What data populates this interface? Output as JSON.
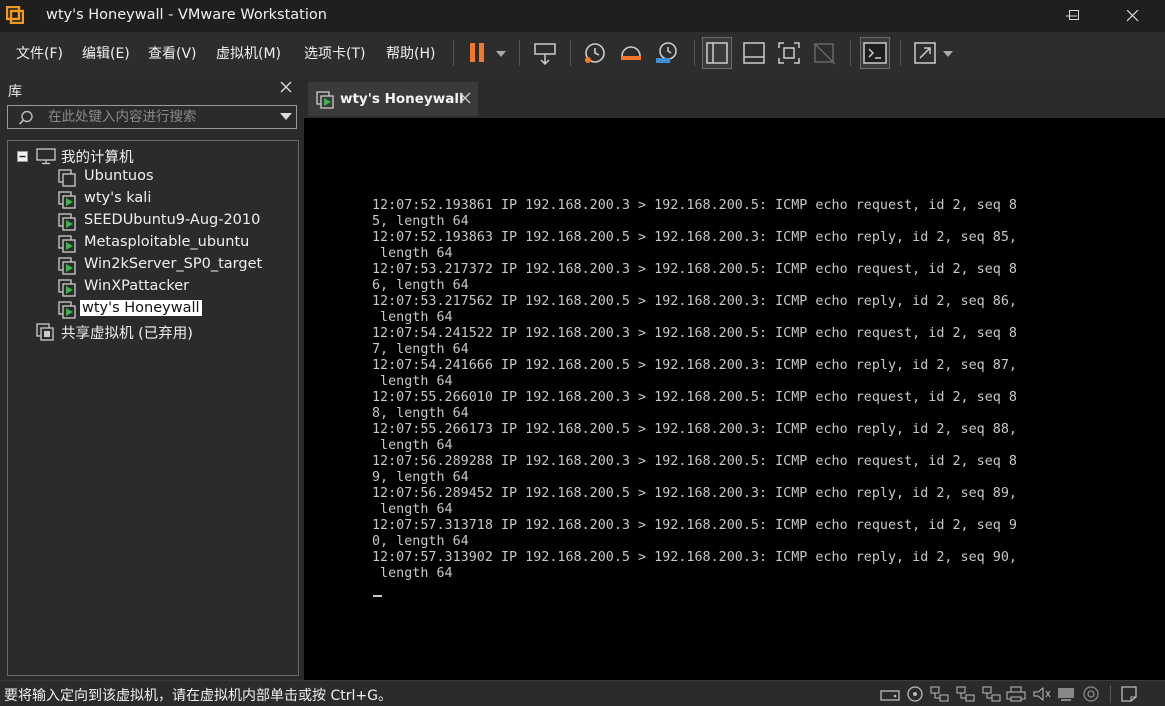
{
  "window": {
    "title": "wty's Honeywall - VMware Workstation"
  },
  "menu": [
    "文件(F)",
    "编辑(E)",
    "查看(V)",
    "虚拟机(M)",
    "选项卡(T)",
    "帮助(H)"
  ],
  "library": {
    "title": "库",
    "search_placeholder": "在此处键入内容进行搜索",
    "root": "我的计算机",
    "vms": [
      "Ubuntuos",
      "wty's kali",
      "SEEDUbuntu9-Aug-2010",
      "Metasploitable_ubuntu",
      "Win2kServer_SP0_target",
      "WinXPattacker",
      "wty's Honeywall"
    ],
    "selected_vm": "wty's Honeywall",
    "shared": "共享虚拟机 (已弃用)"
  },
  "tab": {
    "label": "wty's Honeywall"
  },
  "console": {
    "lines": [
      "12:07:52.193861 IP 192.168.200.3 > 192.168.200.5: ICMP echo request, id 2, seq 8",
      "5, length 64",
      "12:07:52.193863 IP 192.168.200.5 > 192.168.200.3: ICMP echo reply, id 2, seq 85,",
      " length 64",
      "12:07:53.217372 IP 192.168.200.3 > 192.168.200.5: ICMP echo request, id 2, seq 8",
      "6, length 64",
      "12:07:53.217562 IP 192.168.200.5 > 192.168.200.3: ICMP echo reply, id 2, seq 86,",
      " length 64",
      "12:07:54.241522 IP 192.168.200.3 > 192.168.200.5: ICMP echo request, id 2, seq 8",
      "7, length 64",
      "12:07:54.241666 IP 192.168.200.5 > 192.168.200.3: ICMP echo reply, id 2, seq 87,",
      " length 64",
      "12:07:55.266010 IP 192.168.200.3 > 192.168.200.5: ICMP echo request, id 2, seq 8",
      "8, length 64",
      "12:07:55.266173 IP 192.168.200.5 > 192.168.200.3: ICMP echo reply, id 2, seq 88,",
      " length 64",
      "12:07:56.289288 IP 192.168.200.3 > 192.168.200.5: ICMP echo request, id 2, seq 8",
      "9, length 64",
      "12:07:56.289452 IP 192.168.200.5 > 192.168.200.3: ICMP echo reply, id 2, seq 89,",
      " length 64",
      "12:07:57.313718 IP 192.168.200.3 > 192.168.200.5: ICMP echo request, id 2, seq 9",
      "0, length 64",
      "12:07:57.313902 IP 192.168.200.5 > 192.168.200.3: ICMP echo reply, id 2, seq 90,",
      " length 64"
    ]
  },
  "status": {
    "text": "要将输入定向到该虚拟机，请在虚拟机内部单击或按 Ctrl+G。"
  },
  "colors": {
    "pause_accent": "#f07828",
    "vm_running_green": "#3cb44a",
    "console_bg": "#000000"
  }
}
